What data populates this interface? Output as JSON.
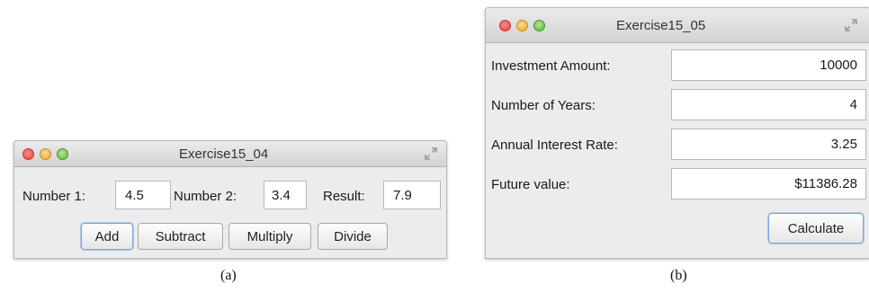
{
  "window_a": {
    "title": "Exercise15_04",
    "number1_label": "Number 1:",
    "number1_value": "4.5",
    "number2_label": "Number 2:",
    "number2_value": "3.4",
    "result_label": "Result:",
    "result_value": "7.9",
    "buttons": [
      "Add",
      "Subtract",
      "Multiply",
      "Divide"
    ],
    "caption": "(a)"
  },
  "window_b": {
    "title": "Exercise15_05",
    "rows": [
      {
        "label": "Investment Amount:",
        "value": "10000"
      },
      {
        "label": "Number of Years:",
        "value": "4"
      },
      {
        "label": "Annual Interest Rate:",
        "value": "3.25"
      },
      {
        "label": "Future value:",
        "value": "$11386.28"
      }
    ],
    "calculate_label": "Calculate",
    "caption": "(b)"
  }
}
